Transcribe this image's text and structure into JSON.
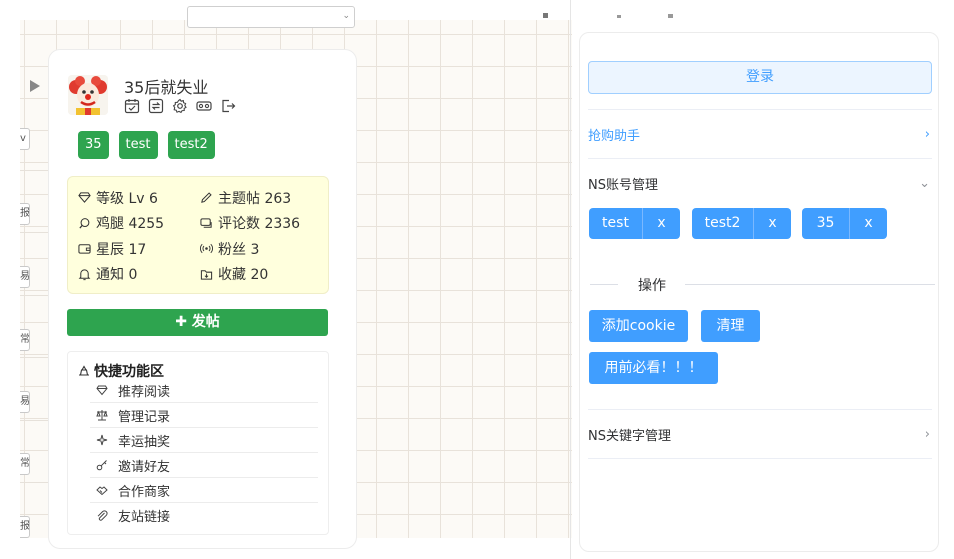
{
  "user": {
    "name": "35后就失业",
    "tags": [
      "35",
      "test",
      "test2"
    ],
    "stats": [
      [
        {
          "icon": "diamond-icon",
          "label": "等级 Lv 6"
        },
        {
          "icon": "pencil-icon",
          "label": "主题帖 263"
        }
      ],
      [
        {
          "icon": "drumstick-icon",
          "label": "鸡腿 4255"
        },
        {
          "icon": "comments-icon",
          "label": "评论数 2336"
        }
      ],
      [
        {
          "icon": "wallet-icon",
          "label": "星辰 17"
        },
        {
          "icon": "broadcast-icon",
          "label": "粉丝 3"
        }
      ],
      [
        {
          "icon": "bell-icon",
          "label": "通知 0"
        },
        {
          "icon": "bookmark-icon",
          "label": "收藏 20"
        }
      ]
    ],
    "post_label": "✚ 发帖"
  },
  "quick": {
    "title": "快捷功能区",
    "items": [
      {
        "icon": "gem-icon",
        "label": "推荐阅读"
      },
      {
        "icon": "scale-icon",
        "label": "管理记录"
      },
      {
        "icon": "sparkle-icon",
        "label": "幸运抽奖"
      },
      {
        "icon": "key-icon",
        "label": "邀请好友"
      },
      {
        "icon": "handshake-icon",
        "label": "合作商家"
      },
      {
        "icon": "paperclip-icon",
        "label": "友站链接"
      }
    ]
  },
  "left_strip": [
    "v",
    "报",
    "易",
    "常",
    "易",
    "常",
    "报"
  ],
  "panel": {
    "login_label": "登录",
    "helper_label": "抢购助手",
    "account_mgmt_label": "NS账号管理",
    "accounts": [
      {
        "name": "test",
        "remove": "x"
      },
      {
        "name": "test2",
        "remove": "x"
      },
      {
        "name": "35",
        "remove": "x"
      }
    ],
    "ops_label": "操作",
    "add_cookie_label": "添加cookie",
    "clear_label": "清理",
    "readme_label": "用前必看！！！",
    "keyword_mgmt_label": "NS关键字管理"
  },
  "colors": {
    "green": "#2ea44f",
    "blue": "#409eff",
    "stats_bg": "#ffffdd"
  }
}
